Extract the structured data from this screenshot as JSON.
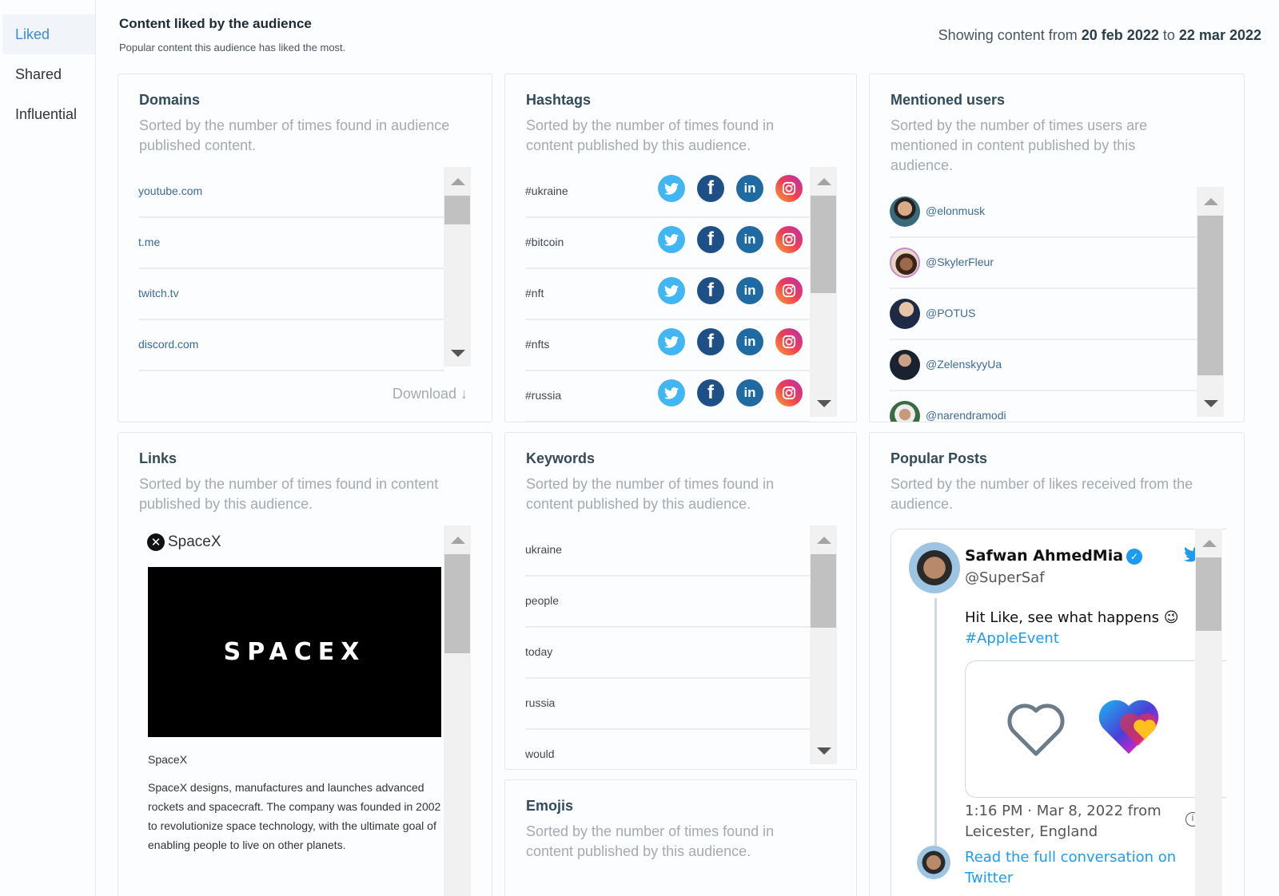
{
  "sidebar": {
    "items": [
      {
        "label": "Liked",
        "active": true
      },
      {
        "label": "Shared",
        "active": false
      },
      {
        "label": "Influential",
        "active": false
      }
    ]
  },
  "header": {
    "title": "Content liked by the audience",
    "subtitle": "Popular content this audience has liked the most.",
    "date_prefix": "Showing content from",
    "date_from": "20 feb 2022",
    "date_joiner": "to",
    "date_to": "22 mar 2022"
  },
  "domains": {
    "title": "Domains",
    "description": "Sorted by the number of times found in audience published content.",
    "items": [
      "youtube.com",
      "t.me",
      "twitch.tv",
      "discord.com"
    ],
    "download_label": "Download",
    "download_icon": "arrow-down-icon"
  },
  "hashtags": {
    "title": "Hashtags",
    "description": "Sorted by the number of times found in content published by this audience.",
    "items": [
      "#ukraine",
      "#bitcoin",
      "#nft",
      "#nfts",
      "#russia"
    ],
    "share_icons": [
      "twitter-icon",
      "facebook-icon",
      "linkedin-icon",
      "instagram-icon"
    ]
  },
  "mentioned_users": {
    "title": "Mentioned users",
    "description": "Sorted by the number of times users are mentioned in content published by this audience.",
    "items": [
      "@elonmusk",
      "@SkylerFleur",
      "@POTUS",
      "@ZelenskyyUa",
      "@narendramodi"
    ]
  },
  "links": {
    "title": "Links",
    "description": "Sorted by the number of times found in content published by this audience.",
    "preview": {
      "site": "SpaceX",
      "image_text": "SPACEX",
      "name": "SpaceX",
      "description": "SpaceX designs, manufactures and launches advanced rockets and spacecraft. The company was founded in 2002 to revolutionize space technology, with the ultimate goal of enabling people to live on other planets."
    }
  },
  "keywords": {
    "title": "Keywords",
    "description": "Sorted by the number of times found in content published by this audience.",
    "items": [
      "ukraine",
      "people",
      "today",
      "russia",
      "would"
    ]
  },
  "emojis": {
    "title": "Emojis",
    "description": "Sorted by the number of times found in content published by this audience."
  },
  "popular_posts": {
    "title": "Popular Posts",
    "description": "Sorted by the number of likes received from the audience.",
    "tweet": {
      "name": "Safwan AhmedMia",
      "handle": "@SuperSaf",
      "text": "Hit Like, see what happens 😉",
      "hashtag": "#AppleEvent",
      "timestamp": "1:16 PM · Mar 8, 2022 from Leicester, England",
      "read_more": "Read the full conversation on Twitter",
      "verified_mark": "✓",
      "info_mark": "i"
    }
  },
  "colors": {
    "accent": "#3b8ad8",
    "link": "#3c6a99",
    "twitter": "#41b6f2",
    "facebook": "#1e4f87",
    "linkedin": "#1f6aa3"
  }
}
